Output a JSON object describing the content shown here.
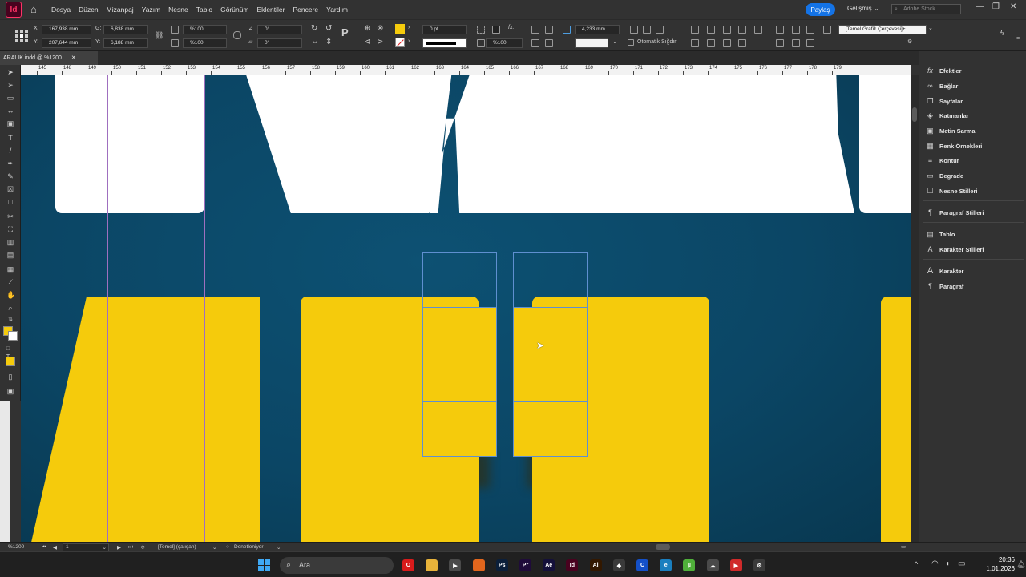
{
  "app": {
    "logo": "Id"
  },
  "menu": [
    "Dosya",
    "Düzen",
    "Mizanpaj",
    "Yazım",
    "Nesne",
    "Tablo",
    "Görünüm",
    "Eklentiler",
    "Pencere",
    "Yardım"
  ],
  "header": {
    "share_label": "Paylaş",
    "workspace": "Gelişmiş",
    "stock_placeholder": "Adobe Stock"
  },
  "control": {
    "x_label": "X:",
    "x_value": "167,938 mm",
    "y_label": "Y:",
    "y_value": "207,644 mm",
    "w_label": "G:",
    "w_value": "6,838 mm",
    "h_label": "Y:",
    "h_value": "6,188 mm",
    "scale_x": "%100",
    "scale_y": "%100",
    "rotate": "0°",
    "shear": "0°",
    "stroke_weight": "0 pt",
    "opacity": "%100",
    "gap_value": "4,233 mm",
    "auto_fit_label": "Otomatik Sığdır",
    "frame_style": "[Temel Grafik Çerçevesi]+",
    "fill_color": "#f5cb0c"
  },
  "document": {
    "tab_label": "ARALIK.indd @ %1200"
  },
  "ruler": {
    "labels": [
      "145",
      "148",
      "149",
      "150",
      "151",
      "152",
      "153",
      "154",
      "155",
      "156",
      "157",
      "158",
      "159",
      "160",
      "161",
      "162",
      "163",
      "164",
      "165",
      "166",
      "167",
      "168",
      "169",
      "170",
      "171",
      "172",
      "173",
      "174",
      "175",
      "176",
      "177",
      "178",
      "179"
    ]
  },
  "panels": [
    "Efektler",
    "Bağlar",
    "Sayfalar",
    "Katmanlar",
    "Metin Sarma",
    "Renk Örnekleri",
    "Kontur",
    "Degrade",
    "Nesne Stilleri",
    "Paragraf Stilleri",
    "Tablo",
    "Karakter Stilleri",
    "Karakter",
    "Paragraf"
  ],
  "status": {
    "zoom": "%1200",
    "page": "1",
    "master": "[Temel] (çalışan)",
    "preflight": "Denetleniyor"
  },
  "taskbar": {
    "search_placeholder": "Ara",
    "apps": [
      {
        "icon": "opera-icon",
        "label": "O",
        "color": "#d81b1b"
      },
      {
        "icon": "folder-icon",
        "label": "",
        "color": "#e8b33a"
      },
      {
        "icon": "media-player-icon",
        "label": "▶",
        "color": "#4a4a4a"
      },
      {
        "icon": "firefox-icon",
        "label": "",
        "color": "#e2661d"
      },
      {
        "icon": "photoshop-icon",
        "label": "Ps",
        "color": "#0b1f3a"
      },
      {
        "icon": "premiere-icon",
        "label": "Pr",
        "color": "#1f0b3a"
      },
      {
        "icon": "after-effects-icon",
        "label": "Ae",
        "color": "#14103a"
      },
      {
        "icon": "indesign-icon",
        "label": "Id",
        "color": "#49021f"
      },
      {
        "icon": "illustrator-icon",
        "label": "Ai",
        "color": "#331800"
      },
      {
        "icon": "unity-icon",
        "label": "◆",
        "color": "#3a3a3a"
      },
      {
        "icon": "blue-app-icon",
        "label": "C",
        "color": "#1450c8"
      },
      {
        "icon": "edge-icon",
        "label": "e",
        "color": "#1a7fbf"
      },
      {
        "icon": "utorrent-icon",
        "label": "µ",
        "color": "#4fb03a"
      },
      {
        "icon": "cloud-app-icon",
        "label": "☁",
        "color": "#4a4a4a"
      },
      {
        "icon": "red-app-icon",
        "label": "▶",
        "color": "#d02a2a"
      },
      {
        "icon": "settings-icon",
        "label": "⚙",
        "color": "#3a3a3a"
      }
    ],
    "time": "20:36",
    "date": "1.01.2026"
  }
}
